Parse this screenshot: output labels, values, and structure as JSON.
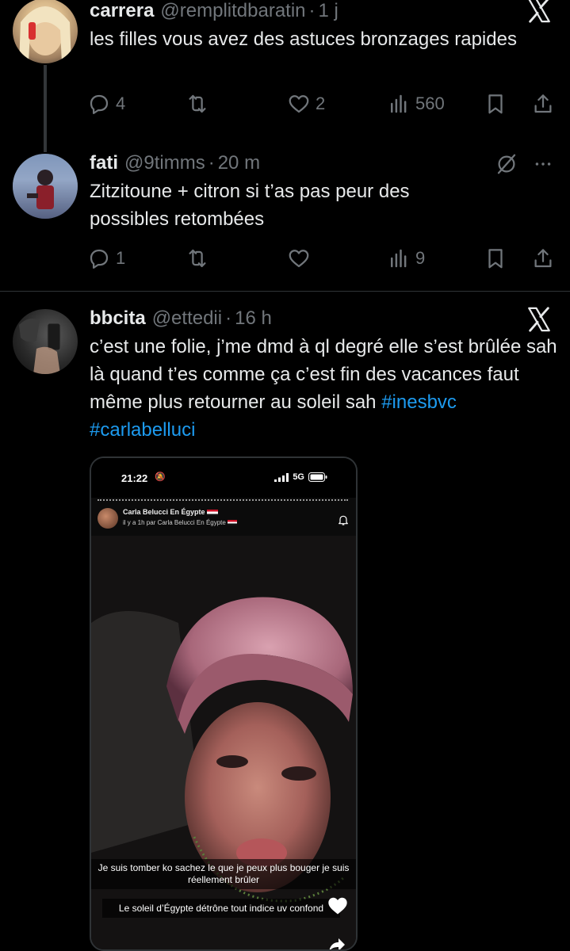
{
  "tweets": [
    {
      "name": "carrera",
      "handle": "@remplitdbaratin",
      "time": "1 j",
      "text": "les filles vous avez des astuces bronzages rapides",
      "replies": "4",
      "reposts": "",
      "likes": "2",
      "views": "560"
    },
    {
      "name": "fati",
      "handle": "@9timms",
      "time": "20 m",
      "text": "Zitzitoune + citron si t’as pas peur des possibles retombées",
      "replies": "1",
      "reposts": "",
      "likes": "",
      "views": "9"
    },
    {
      "name": "bbcita",
      "handle": "@ettedii",
      "time": "16 h",
      "text": "c’est une folie, j’me dmd à ql degré elle s’est brûlée sah là quand t’es comme ça c’est fin des vacances faut même plus retourner au soleil sah",
      "hashtags": [
        "#inesbvc",
        "#carlabelluci"
      ]
    }
  ],
  "embedded_story": {
    "status_time": "21:22",
    "network": "5G",
    "account_name": "Carla Belucci En Égypte",
    "subtitle": "il y a 1h par Carla Belucci En Égypte",
    "caption_1": "Je suis tomber ko sachez le que je peux plus bouger je suis réellement brûler",
    "caption_2": "Le soleil d’Égypte détrône tout indice uv confond"
  },
  "colors": {
    "background": "#000000",
    "text": "#e7e9ea",
    "secondary": "#71767b",
    "hashtag": "#1d9bf0",
    "divider": "#2f3336"
  },
  "icons": [
    "x-logo-icon",
    "grok-icon",
    "more-icon",
    "reply-icon",
    "repost-icon",
    "like-icon",
    "views-icon",
    "bookmark-icon",
    "share-icon",
    "bell-icon",
    "heart-icon"
  ]
}
